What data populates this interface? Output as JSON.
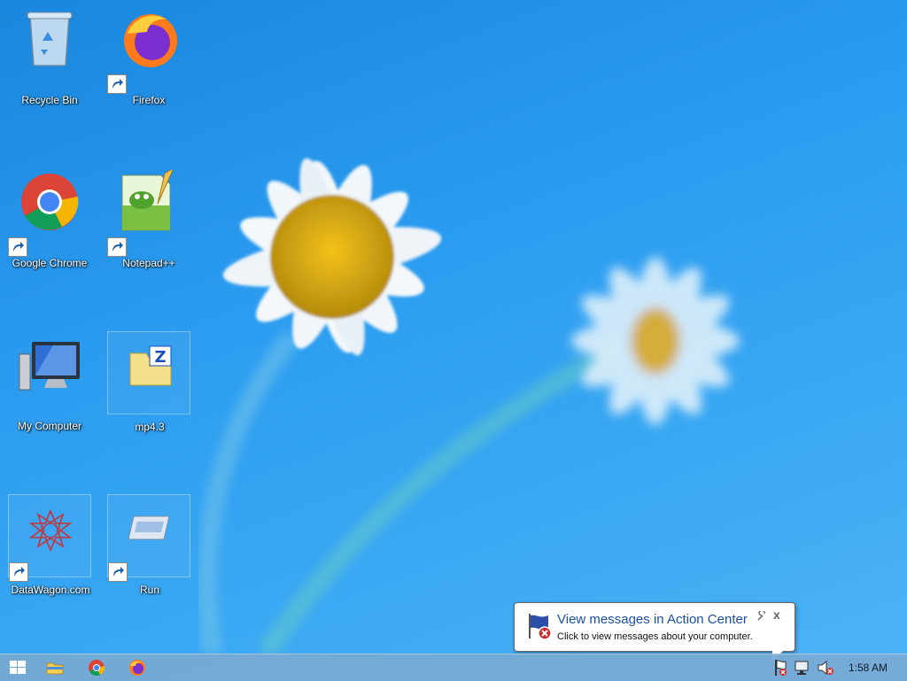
{
  "desktop": {
    "icons": [
      {
        "label": "Recycle Bin",
        "icon": "recycle-bin-icon"
      },
      {
        "label": "Firefox",
        "icon": "firefox-icon"
      },
      {
        "label": "Google Chrome",
        "icon": "chrome-icon"
      },
      {
        "label": "Notepad++",
        "icon": "notepadpp-icon"
      },
      {
        "label": "My Computer",
        "icon": "computer-icon"
      },
      {
        "label": "mp4.3",
        "icon": "zip-folder-icon"
      },
      {
        "label": "DataWagon.com",
        "icon": "datawagon-icon"
      },
      {
        "label": "Run",
        "icon": "run-icon"
      }
    ]
  },
  "notification": {
    "title": "View messages in Action Center",
    "body": "Click to view messages about your computer.",
    "close_label": "x"
  },
  "taskbar": {
    "items": [
      "start-button",
      "file-explorer",
      "chrome",
      "firefox"
    ],
    "clock": "1:58 AM"
  },
  "colors": {
    "accent": "#1b4fa8",
    "wallpaper": "#2b9cf0"
  }
}
